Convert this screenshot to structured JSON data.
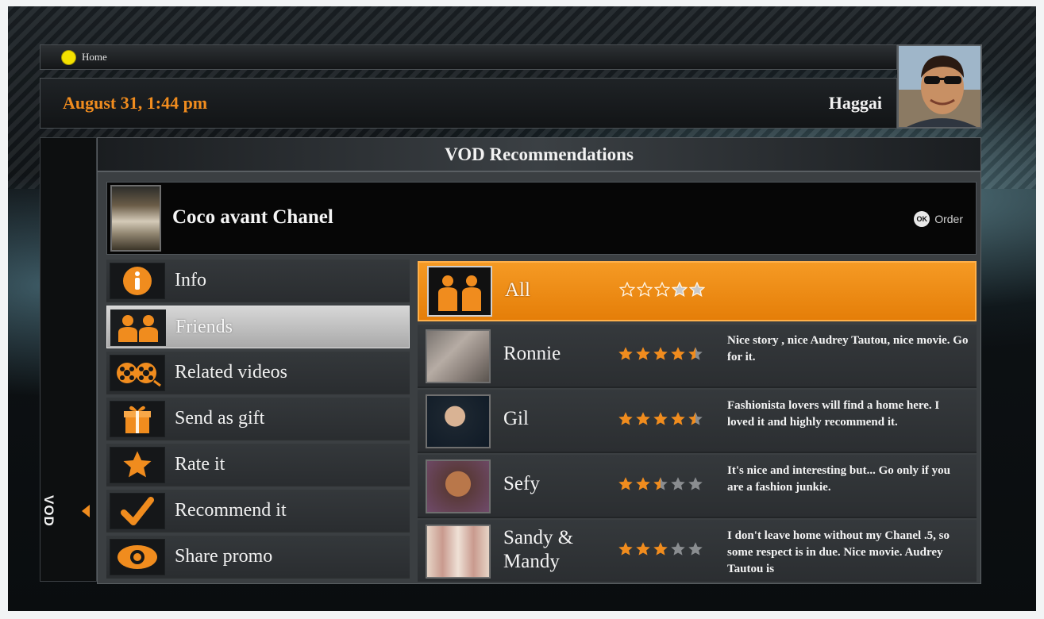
{
  "breadcrumb": {
    "label": "Home"
  },
  "header": {
    "datetime": "August 31, 1:44 pm",
    "user_name": "Haggai"
  },
  "side_tab": {
    "label": "VOD"
  },
  "section": {
    "title": "VOD Recommendations"
  },
  "movie": {
    "title": "Coco avant Chanel",
    "order_button_glyph": "OK",
    "order_label": "Order"
  },
  "menu": {
    "items": [
      {
        "label": "Info",
        "icon": "info-icon"
      },
      {
        "label": "Friends",
        "icon": "friends-icon",
        "selected": true
      },
      {
        "label": "Related videos",
        "icon": "film-reels-icon"
      },
      {
        "label": "Send as gift",
        "icon": "gift-icon"
      },
      {
        "label": "Rate it",
        "icon": "star-icon"
      },
      {
        "label": "Recommend it",
        "icon": "checkmark-icon"
      },
      {
        "label": "Share promo",
        "icon": "eye-icon"
      }
    ]
  },
  "friends": {
    "rows": [
      {
        "name": "All",
        "rating": 0,
        "comment": "",
        "selected": true
      },
      {
        "name": "Ronnie",
        "rating": 4.5,
        "comment": "Nice story , nice Audrey Tautou, nice movie. Go for it."
      },
      {
        "name": "Gil",
        "rating": 4.5,
        "comment": "Fashionista lovers will find a home here. I loved it and highly recommend it."
      },
      {
        "name": "Sefy",
        "rating": 2.5,
        "comment": "It's nice and interesting but... Go only if you are a fashion junkie."
      },
      {
        "name": "Sandy & Mandy",
        "rating": 3,
        "comment": "I don't leave home without my Chanel .5, so some respect is in due. Nice movie. Audrey Tautou is"
      }
    ]
  },
  "colors": {
    "accent": "#f08c1e",
    "selected_row": "#f08c1e",
    "star_filled": "#f08c1e",
    "star_empty": "#8a8d90"
  }
}
